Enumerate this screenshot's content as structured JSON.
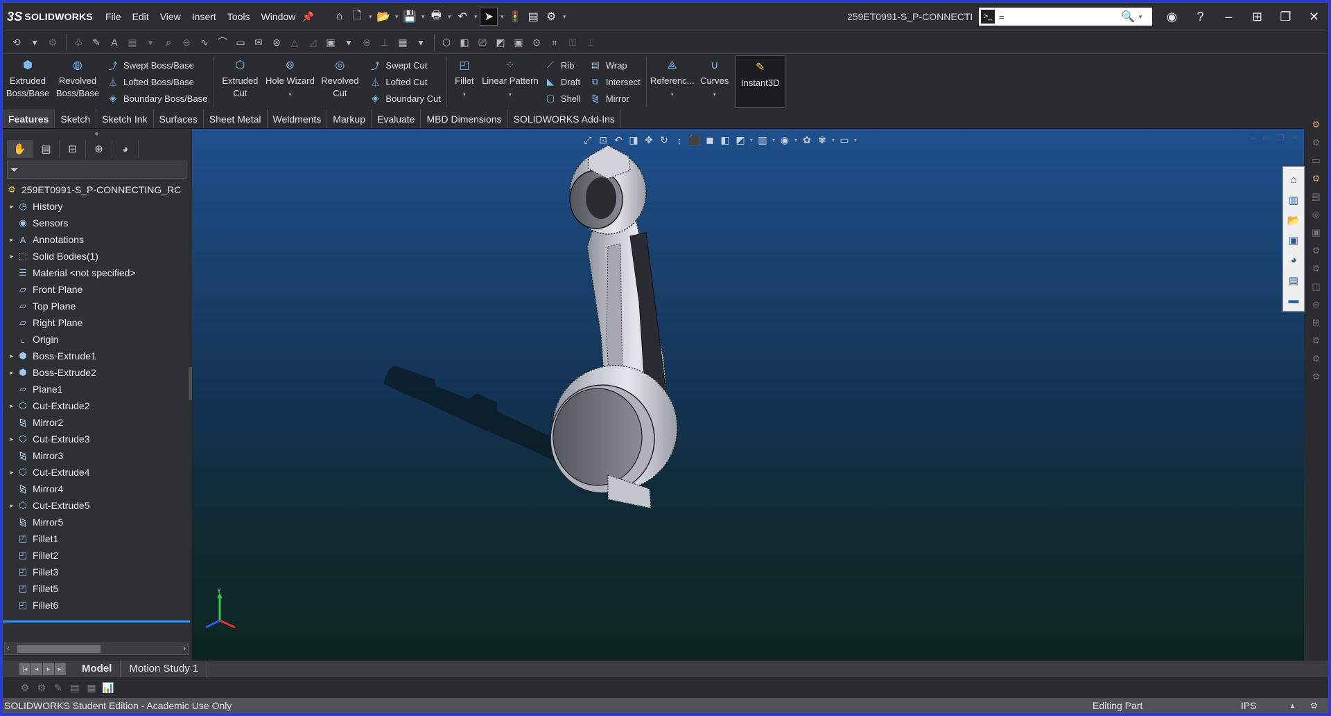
{
  "app": {
    "logo_text": "SOLIDWORKS",
    "logo_mark": "3S"
  },
  "menu": [
    "File",
    "Edit",
    "View",
    "Insert",
    "Tools",
    "Window"
  ],
  "document_title": "259ET0991-S_P-CONNECTI...",
  "search": {
    "value": "="
  },
  "ribbon": {
    "extruded_boss": "Extruded Boss/Base",
    "revolved_boss": "Revolved Boss/Base",
    "swept_boss": "Swept Boss/Base",
    "lofted_boss": "Lofted Boss/Base",
    "boundary_boss": "Boundary Boss/Base",
    "extruded_cut": "Extruded Cut",
    "hole_wizard": "Hole Wizard",
    "revolved_cut": "Revolved Cut",
    "swept_cut": "Swept Cut",
    "lofted_cut": "Lofted Cut",
    "boundary_cut": "Boundary Cut",
    "fillet": "Fillet",
    "linear_pattern": "Linear Pattern",
    "rib": "Rib",
    "draft": "Draft",
    "shell": "Shell",
    "wrap": "Wrap",
    "intersect": "Intersect",
    "mirror": "Mirror",
    "reference": "Referenc...",
    "curves": "Curves",
    "instant3d": "Instant3D"
  },
  "tabs": [
    "Features",
    "Sketch",
    "Sketch Ink",
    "Surfaces",
    "Sheet Metal",
    "Weldments",
    "Markup",
    "Evaluate",
    "MBD Dimensions",
    "SOLIDWORKS Add-Ins"
  ],
  "active_tab": "Features",
  "tree": {
    "root": "259ET0991-S_P-CONNECTING_RC",
    "items": [
      {
        "label": "History",
        "icon": "history-icon",
        "expandable": true
      },
      {
        "label": "Sensors",
        "icon": "sensors-icon",
        "expandable": false
      },
      {
        "label": "Annotations",
        "icon": "annotations-icon",
        "expandable": true
      },
      {
        "label": "Solid Bodies(1)",
        "icon": "solid-bodies-icon",
        "expandable": true
      },
      {
        "label": "Material <not specified>",
        "icon": "material-icon",
        "expandable": false
      },
      {
        "label": "Front Plane",
        "icon": "plane-icon",
        "expandable": false
      },
      {
        "label": "Top Plane",
        "icon": "plane-icon",
        "expandable": false
      },
      {
        "label": "Right Plane",
        "icon": "plane-icon",
        "expandable": false
      },
      {
        "label": "Origin",
        "icon": "origin-icon",
        "expandable": false
      },
      {
        "label": "Boss-Extrude1",
        "icon": "boss-extrude-icon",
        "expandable": true
      },
      {
        "label": "Boss-Extrude2",
        "icon": "boss-extrude-icon",
        "expandable": true
      },
      {
        "label": "Plane1",
        "icon": "plane-icon",
        "expandable": false
      },
      {
        "label": "Cut-Extrude2",
        "icon": "cut-extrude-icon",
        "expandable": true
      },
      {
        "label": "Mirror2",
        "icon": "mirror-icon",
        "expandable": false
      },
      {
        "label": "Cut-Extrude3",
        "icon": "cut-extrude-icon",
        "expandable": true
      },
      {
        "label": "Mirror3",
        "icon": "mirror-icon",
        "expandable": false
      },
      {
        "label": "Cut-Extrude4",
        "icon": "cut-extrude-icon",
        "expandable": true
      },
      {
        "label": "Mirror4",
        "icon": "mirror-icon",
        "expandable": false
      },
      {
        "label": "Cut-Extrude5",
        "icon": "cut-extrude-icon",
        "expandable": true
      },
      {
        "label": "Mirror5",
        "icon": "mirror-icon",
        "expandable": false
      },
      {
        "label": "Fillet1",
        "icon": "fillet-icon",
        "expandable": false
      },
      {
        "label": "Fillet2",
        "icon": "fillet-icon",
        "expandable": false
      },
      {
        "label": "Fillet3",
        "icon": "fillet-icon",
        "expandable": false
      },
      {
        "label": "Fillet5",
        "icon": "fillet-icon",
        "expandable": false
      },
      {
        "label": "Fillet6",
        "icon": "fillet-icon",
        "expandable": false
      }
    ]
  },
  "bottom_tabs": [
    "Model",
    "Motion Study 1"
  ],
  "status": {
    "left": "SOLIDWORKS Student Edition - Academic Use Only",
    "mode": "Editing Part",
    "units": "IPS"
  },
  "triad": {
    "y": "Y"
  },
  "colors": {
    "accent": "#2c3bd6",
    "viewport_top": "#1f4f8e",
    "viewport_bottom": "#0d241f",
    "tree_selection": "#3d8ee0"
  }
}
